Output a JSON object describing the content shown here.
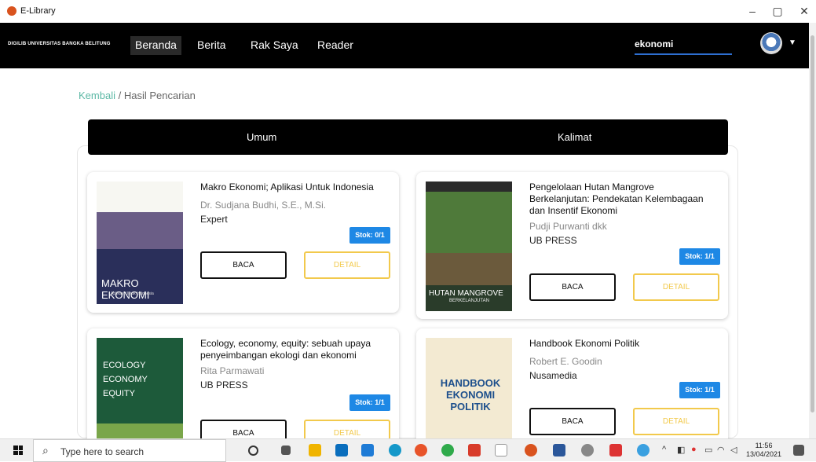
{
  "window": {
    "title": "E-Library",
    "minimize": "–",
    "maximize": "▢",
    "close": "✕"
  },
  "navbar": {
    "brand": "DIGILIB UNIVERSITAS BANGKA BELITUNG",
    "items": [
      {
        "label": "Beranda"
      },
      {
        "label": "Berita"
      },
      {
        "label": "Rak Saya"
      },
      {
        "label": "Reader"
      }
    ],
    "search_value": "ekonomi"
  },
  "breadcrumb": {
    "back": "Kembali",
    "sep": "/",
    "current": "Hasil Pencarian"
  },
  "tabs": [
    {
      "label": "Umum"
    },
    {
      "label": "Kalimat"
    }
  ],
  "books": [
    {
      "title": "Makro Ekonomi; Aplikasi Untuk Indonesia",
      "author": "Dr. Sudjana Budhi, S.E., M.Si.",
      "publisher": "Expert",
      "stock": "Stok: 0/1",
      "read": "BACA",
      "detail": "DETAIL",
      "cover_text": "MAKRO EKONOMI",
      "cover_sub": "Aplikasi Untuk Indonesia"
    },
    {
      "title": "Pengelolaan Hutan Mangrove Berkelanjutan: Pendekatan Kelembagaan dan Insentif Ekonomi",
      "author": "Pudji Purwanti dkk",
      "publisher": "UB PRESS",
      "stock": "Stok: 1/1",
      "read": "BACA",
      "detail": "DETAIL",
      "cover_text": "HUTAN MANGROVE",
      "cover_sub": "BERKELANJUTAN"
    },
    {
      "title": "Ecology, economy, equity: sebuah upaya penyeimbangan ekologi dan ekonomi",
      "author": "Rita Parmawati",
      "publisher": "UB PRESS",
      "stock": "Stok: 1/1",
      "read": "BACA",
      "detail": "DETAIL",
      "cover_text": "ECOLOGY ECONOMY EQUITY",
      "cover_sub": ""
    },
    {
      "title": "Handbook Ekonomi Politik",
      "author": "Robert E. Goodin",
      "publisher": "Nusamedia",
      "stock": "Stok: 1/1",
      "read": "BACA",
      "detail": "DETAIL",
      "cover_text": "HANDBOOK EKONOMI POLITIK",
      "cover_sub": ""
    }
  ],
  "taskbar": {
    "search_placeholder": "Type here to search",
    "time": "11:56",
    "date": "13/04/2021"
  }
}
